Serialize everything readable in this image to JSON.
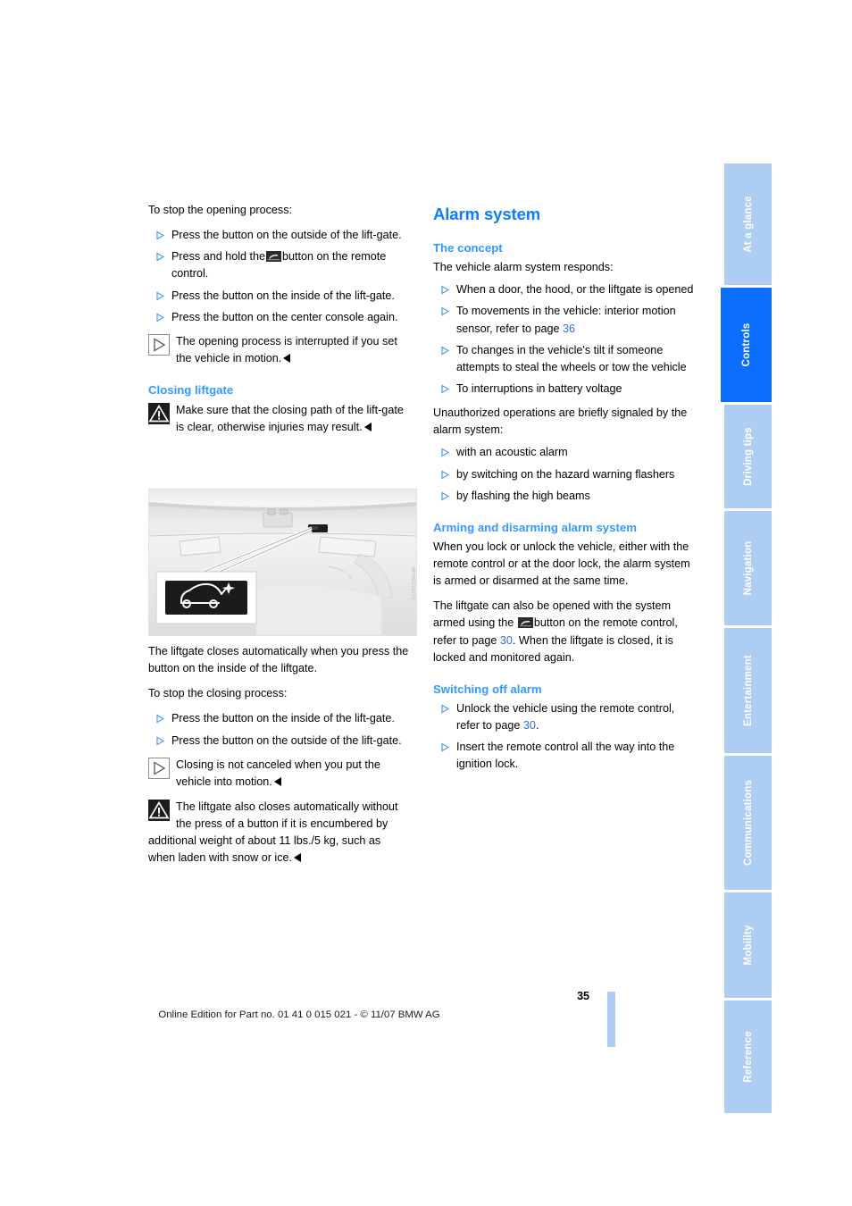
{
  "document": {
    "page_number": "35",
    "edition_line": "Online Edition for Part no. 01 41 0 015 021 - © 11/07 BMW AG"
  },
  "left_column": {
    "intro": "To stop the opening process:",
    "opening_steps": [
      "Press the button on the outside of the lift-gate.",
      "Press and hold the  button on the remote control.",
      "Press the button on the inside of the lift-gate.",
      "Press the button on the center console again."
    ],
    "opening_note": {
      "icon": "info-arrow-icon",
      "text": "The opening process is interrupted if you set the vehicle in motion."
    },
    "closing_heading": "Closing liftgate",
    "closing_warning": {
      "icon": "warning-triangle-icon",
      "text": "Make sure that the closing path of the lift-gate is clear, otherwise injuries may result."
    },
    "figure": {
      "caption_watermark": "WPIM0101276",
      "alt": "liftgate interior with close button callout"
    },
    "auto_close_paragraph": "The liftgate closes automatically when you press the button on the inside of the liftgate.",
    "closing_intro": "To stop the closing process:",
    "closing_steps": [
      "Press the button on the inside of the lift-gate.",
      "Press the button on the outside of the lift-gate."
    ],
    "closing_note": {
      "icon": "info-arrow-icon",
      "text": "Closing is not canceled when you put the vehicle into motion."
    },
    "closing_warning2": {
      "icon": "warning-triangle-icon",
      "text": "The liftgate also closes automatically without the press of a button if it is encumbered by additional weight of about 11 lbs./5 kg, such as when laden with snow or ice."
    }
  },
  "right_column": {
    "title": "Alarm system",
    "concept_heading": "The concept",
    "concept_intro": "The vehicle alarm system responds:",
    "concept_items": [
      {
        "text_before": "When a door, the hood, or the liftgate is opened",
        "link": "",
        "text_after": ""
      },
      {
        "text_before": "To movements in the vehicle: interior motion sensor, refer to page ",
        "link": "36",
        "text_after": ""
      },
      {
        "text_before": "To changes in the vehicle's tilt if someone attempts to steal the wheels or tow the vehicle",
        "link": "",
        "text_after": ""
      },
      {
        "text_before": "To interruptions in battery voltage",
        "link": "",
        "text_after": ""
      }
    ],
    "unauthorized_intro": "Unauthorized operations are briefly signaled by the alarm system:",
    "signal_items": [
      "with an acoustic alarm",
      "by switching on the hazard warning flashers",
      "by flashing the high beams"
    ],
    "arming_heading": "Arming and disarming alarm system",
    "arming_paragraph": "When you lock or unlock the vehicle, either with the remote control or at the door lock, the alarm system is armed or disarmed at the same time.",
    "liftgate_paragraph_1": "The liftgate can also be opened with the system armed using the ",
    "liftgate_paragraph_2": "button on the remote control, refer to page ",
    "liftgate_link": "30",
    "liftgate_paragraph_3": ". When the liftgate is closed, it is locked and monitored again.",
    "switching_heading": "Switching off alarm",
    "switching_items": [
      {
        "text_before": "Unlock the vehicle using the remote control, refer to page ",
        "link": "30",
        "text_after": "."
      },
      {
        "text_before": "Insert the remote control all the way into the ignition lock.",
        "link": "",
        "text_after": ""
      }
    ]
  },
  "tabs": [
    {
      "label": "At a glance",
      "active": false
    },
    {
      "label": "Controls",
      "active": true
    },
    {
      "label": "Driving tips",
      "active": false
    },
    {
      "label": "Navigation",
      "active": false
    },
    {
      "label": "Entertainment",
      "active": false
    },
    {
      "label": "Communications",
      "active": false
    },
    {
      "label": "Mobility",
      "active": false
    },
    {
      "label": "Reference",
      "active": false
    }
  ],
  "colors": {
    "heading_blue": "#0d7dfa",
    "subheading_blue": "#3399ff",
    "tab_inactive": "#aecdf2",
    "tab_active": "#0d6efd",
    "link_blue": "#2f6fe0"
  }
}
